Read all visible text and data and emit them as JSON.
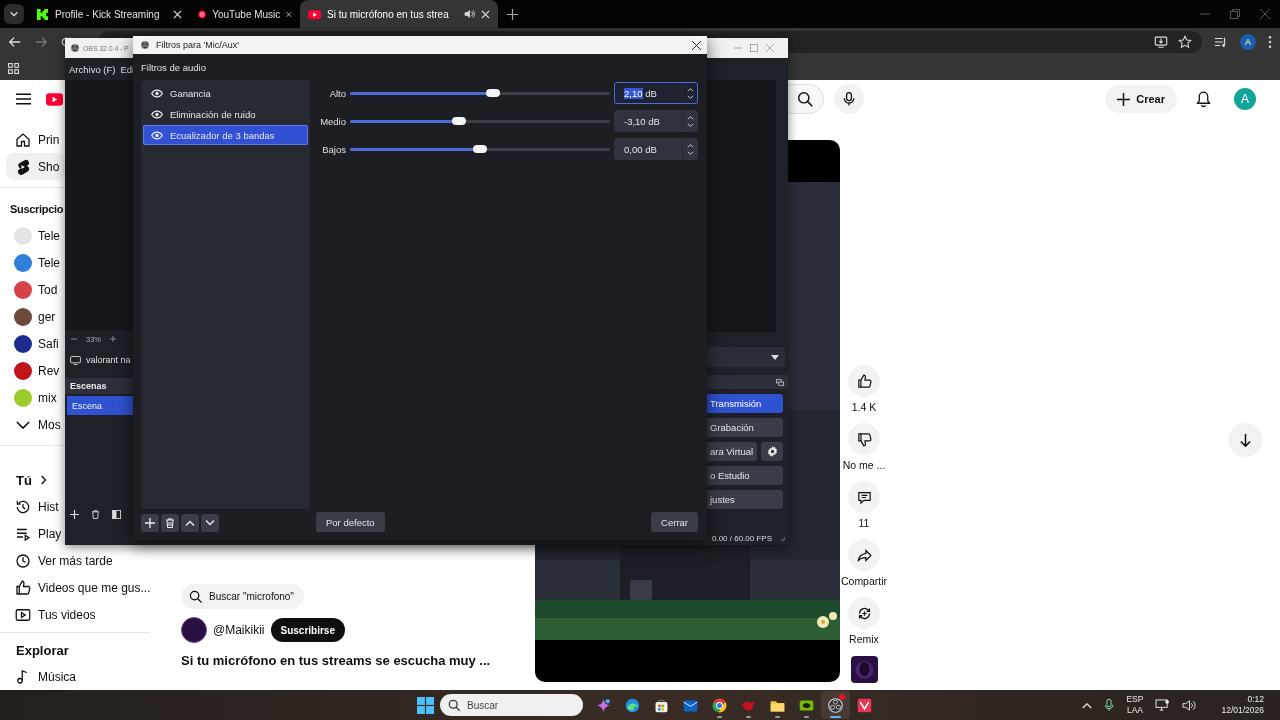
{
  "browser": {
    "tabs": [
      {
        "title": "Profile - Kick Streaming",
        "selected": false,
        "audible": false
      },
      {
        "title": "YouTube Music",
        "selected": false,
        "audible": false
      },
      {
        "title": "Si tu micrófono en tus strea",
        "selected": true,
        "audible": true
      }
    ],
    "profile_letter": "A"
  },
  "youtube": {
    "create_label": "Crear",
    "avatar_letter": "A",
    "sidebar": {
      "main": [
        {
          "label": "Prin",
          "selected": false
        },
        {
          "label": "Sho",
          "selected": true
        }
      ],
      "subscriptions_heading": "Suscripcio",
      "subscriptions": [
        {
          "label": "Tele",
          "color": "#e4e4e4"
        },
        {
          "label": "Tele",
          "color": "#2f80d8"
        },
        {
          "label": "Tod",
          "color": "#d8404a"
        },
        {
          "label": "ger",
          "color": "#6b4a3a"
        },
        {
          "label": "Safi",
          "color": "#1c2c8c"
        },
        {
          "label": "Rev",
          "color": "#c0151b"
        },
        {
          "label": "mix",
          "color": "#9ccc2a"
        }
      ],
      "show_more": "Mos",
      "you_heading": "Tú",
      "you": [
        {
          "label": "Hist"
        },
        {
          "label": "Play"
        },
        {
          "label": "Ver más tarde"
        },
        {
          "label": "Videos que me gus..."
        },
        {
          "label": "Tus videos"
        }
      ],
      "explore_heading": "Explorar",
      "explore": [
        {
          "label": "Música"
        }
      ]
    },
    "short": {
      "search_chip": "Buscar \"microfono\"",
      "channel": "@Maikikii",
      "subscribe": "Suscribirse",
      "title": "Si tu micrófono en tus streams se escucha muy ...",
      "actions": [
        {
          "kind": "like",
          "label": "1.4 K"
        },
        {
          "kind": "dislike",
          "label": "No me ..."
        },
        {
          "kind": "comment",
          "label": "11"
        },
        {
          "kind": "share",
          "label": "Compartir"
        },
        {
          "kind": "remix",
          "label": "Remix"
        }
      ]
    }
  },
  "obs_main": {
    "title": "OBS 32.0.4 - P",
    "menu": [
      "Archivo (F)",
      "Edi"
    ],
    "zoom": "33%",
    "source": "valorant na",
    "scenes_heading": "Escenas",
    "scenes": [
      {
        "name": "Escena",
        "selected": true
      }
    ],
    "controls": [
      {
        "label": "Transmisión",
        "kind": "button",
        "selected": true
      },
      {
        "label": "Grabación",
        "kind": "button",
        "selected": false
      },
      {
        "label": "ara Virtual",
        "kind": "split",
        "selected": false
      },
      {
        "label": "o Estudio",
        "kind": "button",
        "selected": false
      },
      {
        "label": "justes",
        "kind": "button",
        "selected": false
      }
    ],
    "status": "0.00 / 60.00 FPS"
  },
  "filters_dialog": {
    "title": "Filtros para 'Mic/Aux'",
    "section": "Filtros de audio",
    "filters": [
      {
        "name": "Ganancia",
        "visible": true,
        "selected": false
      },
      {
        "name": "Eliminación de ruido",
        "visible": true,
        "selected": false
      },
      {
        "name": "Ecualizador de 3 bandas",
        "visible": true,
        "selected": true
      }
    ],
    "bands": [
      {
        "label": "Alto",
        "level": 0.55,
        "number": "2,10",
        "unit": "dB",
        "focused": true
      },
      {
        "label": "Medio",
        "level": 0.42,
        "number": "-3,10",
        "unit": "dB",
        "focused": false
      },
      {
        "label": "Bajos",
        "level": 0.5,
        "number": "0,00",
        "unit": "dB",
        "focused": false
      }
    ],
    "defaults_button": "Por defecto",
    "close_button": "Cerrar"
  },
  "taskbar": {
    "search_placeholder": "Buscar",
    "apps": [
      {
        "running": false,
        "active": false,
        "alert": false
      },
      {
        "running": false,
        "active": false,
        "alert": false
      },
      {
        "running": false,
        "active": false,
        "alert": false
      },
      {
        "running": false,
        "active": false,
        "alert": false
      },
      {
        "running": true,
        "active": false,
        "alert": false
      },
      {
        "running": true,
        "active": false,
        "alert": false
      },
      {
        "running": true,
        "active": false,
        "alert": false
      },
      {
        "running": true,
        "active": false,
        "alert": false
      },
      {
        "running": true,
        "active": true,
        "alert": true
      },
      {
        "running": false,
        "active": false,
        "alert": false
      }
    ],
    "language": "ESP",
    "layout": "LAA",
    "time": "0:12",
    "date": "12/01/2026"
  }
}
